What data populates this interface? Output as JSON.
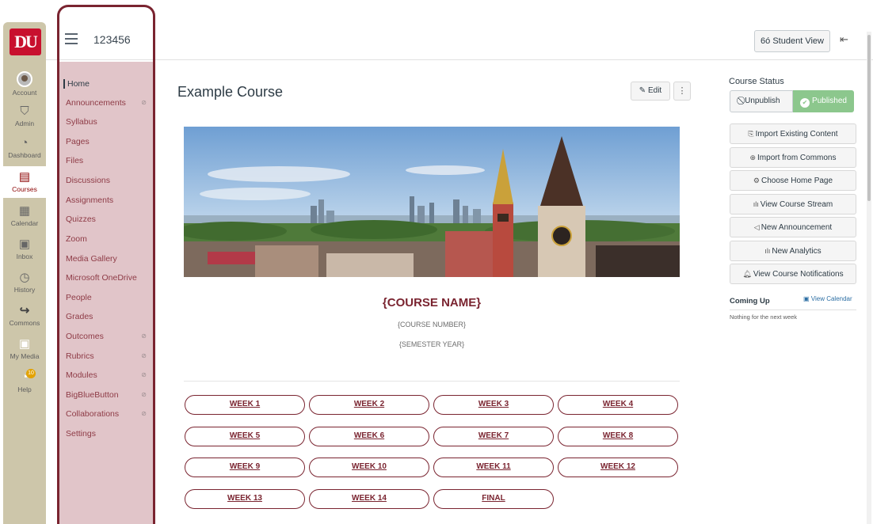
{
  "global_nav": {
    "logo": "DU",
    "items": [
      {
        "label": "Account",
        "icon": "avatar"
      },
      {
        "label": "Admin",
        "icon": "shield-icon"
      },
      {
        "label": "Dashboard",
        "icon": "dashboard-icon"
      },
      {
        "label": "Courses",
        "icon": "book-icon"
      },
      {
        "label": "Calendar",
        "icon": "calendar-icon"
      },
      {
        "label": "Inbox",
        "icon": "inbox-icon"
      },
      {
        "label": "History",
        "icon": "clock-icon"
      },
      {
        "label": "Commons",
        "icon": "commons-arrow-icon"
      },
      {
        "label": "My Media",
        "icon": "media-icon"
      },
      {
        "label": "Help",
        "icon": "help-icon",
        "badge": "10"
      }
    ]
  },
  "header": {
    "course_code": "123456",
    "student_view": "Student View"
  },
  "course_nav": {
    "items": [
      {
        "label": "Home"
      },
      {
        "label": "Announcements"
      },
      {
        "label": "Syllabus"
      },
      {
        "label": "Pages"
      },
      {
        "label": "Files"
      },
      {
        "label": "Discussions"
      },
      {
        "label": "Assignments"
      },
      {
        "label": "Quizzes"
      },
      {
        "label": "Zoom"
      },
      {
        "label": "Media Gallery"
      },
      {
        "label": "Microsoft OneDrive"
      },
      {
        "label": "People"
      },
      {
        "label": "Grades"
      },
      {
        "label": "Outcomes"
      },
      {
        "label": "Rubrics"
      },
      {
        "label": "Modules"
      },
      {
        "label": "BigBlueButton"
      },
      {
        "label": "Collaborations"
      },
      {
        "label": "Settings"
      }
    ]
  },
  "main": {
    "title": "Example Course",
    "edit_label": "Edit",
    "kebab": "⋮",
    "course_name": "{COURSE NAME}",
    "course_number": "{COURSE NUMBER}",
    "semester_year": "{SEMESTER YEAR}",
    "week_buttons": [
      "WEEK 1",
      "WEEK 2",
      "WEEK 3",
      "WEEK 4",
      "WEEK 5",
      "WEEK 6",
      "WEEK 7",
      "WEEK 8",
      "WEEK 9",
      "WEEK 10",
      "WEEK 11",
      "WEEK 12",
      "WEEK 13",
      "WEEK 14",
      "FINAL"
    ]
  },
  "sidebar": {
    "status_label": "Course Status",
    "unpublish": "Unpublish",
    "published": "Published",
    "buttons": [
      "Import Existing Content",
      "Import from Commons",
      "Choose Home Page",
      "View Course Stream",
      "New Announcement",
      "New Analytics",
      "View Course Notifications"
    ],
    "coming_up": "Coming Up",
    "view_calendar": "View Calendar",
    "nothing": "Nothing for the next week"
  },
  "colors": {
    "accent": "#7a2430",
    "published": "#8cc78d",
    "nav_bg": "#cdc6aa",
    "course_nav_bg": "#e1c5c9"
  }
}
